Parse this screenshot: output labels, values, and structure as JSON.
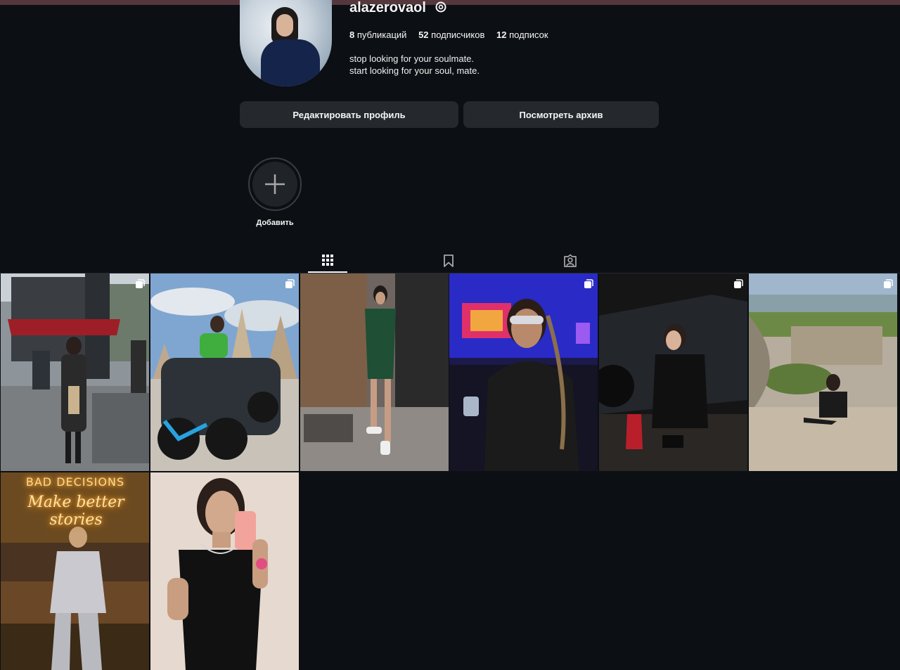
{
  "profile": {
    "username": "alazerovaol",
    "stats": {
      "posts_count": "8",
      "posts_label": "публикаций",
      "followers_count": "52",
      "followers_label": "подписчиков",
      "following_count": "12",
      "following_label": "подписок"
    },
    "bio_line1": "stop looking for your soulmate.",
    "bio_line2": "start looking for your soul, mate."
  },
  "buttons": {
    "edit_profile": "Редактировать профиль",
    "view_archive": "Посмотреть архив"
  },
  "highlights": {
    "add_label": "Добавить"
  },
  "tabs": [
    {
      "name": "posts",
      "icon": "grid-icon",
      "active": true
    },
    {
      "name": "saved",
      "icon": "bookmark-icon",
      "active": false
    },
    {
      "name": "tagged",
      "icon": "tagged-icon",
      "active": false
    }
  ],
  "posts": {
    "neon_line1": "BAD DECISIONS",
    "neon_line2": "Make better stories",
    "multi_photo_icon": "carousel-icon"
  },
  "colors": {
    "background": "#0c0f14",
    "button_bg": "#25292e",
    "top_bar": "#55383e"
  }
}
